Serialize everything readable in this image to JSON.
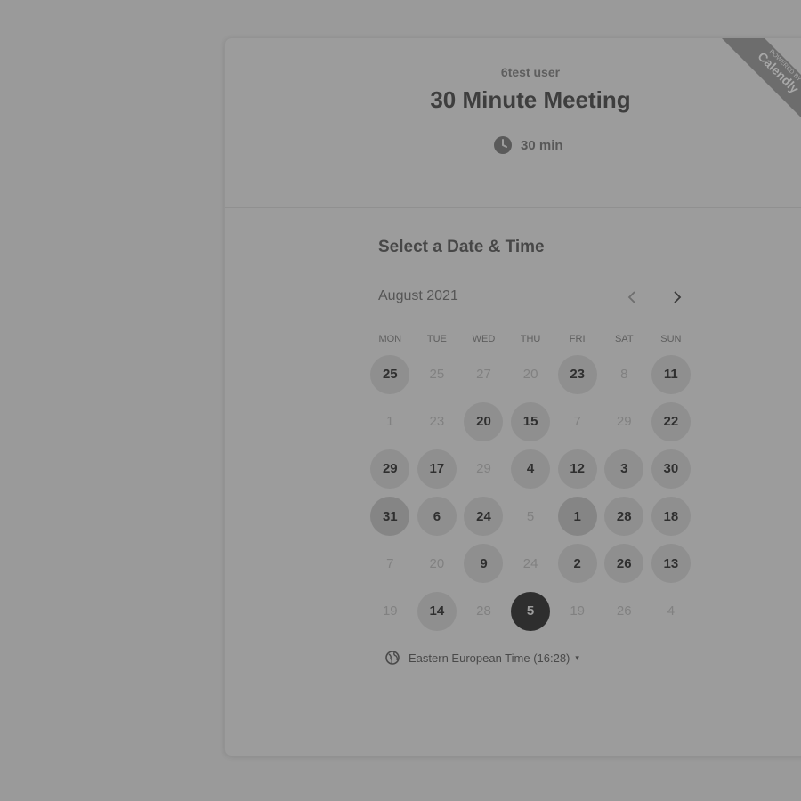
{
  "host": {
    "name": "6test user"
  },
  "event": {
    "title": "30 Minute Meeting",
    "duration": "30 min"
  },
  "ribbon": {
    "top": "POWERED BY",
    "main": "Calendly"
  },
  "calendar": {
    "section_title": "Select a Date & Time",
    "month": "August 2021",
    "prev_icon": "chevron-left-icon",
    "next_icon": "chevron-right-icon",
    "weekdays": [
      "MON",
      "TUE",
      "WED",
      "THU",
      "FRI",
      "SAT",
      "SUN"
    ],
    "days": [
      {
        "n": "25",
        "state": "available"
      },
      {
        "n": "25",
        "state": "unavailable"
      },
      {
        "n": "27",
        "state": "unavailable"
      },
      {
        "n": "20",
        "state": "unavailable"
      },
      {
        "n": "23",
        "state": "available"
      },
      {
        "n": "8",
        "state": "unavailable"
      },
      {
        "n": "11",
        "state": "available"
      },
      {
        "n": "1",
        "state": "unavailable"
      },
      {
        "n": "23",
        "state": "unavailable"
      },
      {
        "n": "20",
        "state": "available"
      },
      {
        "n": "15",
        "state": "available"
      },
      {
        "n": "7",
        "state": "unavailable"
      },
      {
        "n": "29",
        "state": "unavailable"
      },
      {
        "n": "22",
        "state": "available"
      },
      {
        "n": "29",
        "state": "available"
      },
      {
        "n": "17",
        "state": "available"
      },
      {
        "n": "29",
        "state": "unavailable"
      },
      {
        "n": "4",
        "state": "available"
      },
      {
        "n": "12",
        "state": "available"
      },
      {
        "n": "3",
        "state": "available"
      },
      {
        "n": "30",
        "state": "available"
      },
      {
        "n": "31",
        "state": "highlight"
      },
      {
        "n": "6",
        "state": "available"
      },
      {
        "n": "24",
        "state": "available"
      },
      {
        "n": "5",
        "state": "unavailable"
      },
      {
        "n": "1",
        "state": "highlight"
      },
      {
        "n": "28",
        "state": "available"
      },
      {
        "n": "18",
        "state": "available"
      },
      {
        "n": "7",
        "state": "unavailable"
      },
      {
        "n": "20",
        "state": "unavailable"
      },
      {
        "n": "9",
        "state": "available"
      },
      {
        "n": "24",
        "state": "unavailable"
      },
      {
        "n": "2",
        "state": "available"
      },
      {
        "n": "26",
        "state": "available"
      },
      {
        "n": "13",
        "state": "available"
      },
      {
        "n": "19",
        "state": "unavailable"
      },
      {
        "n": "14",
        "state": "available"
      },
      {
        "n": "28",
        "state": "unavailable"
      },
      {
        "n": "5",
        "state": "selected"
      },
      {
        "n": "19",
        "state": "unavailable"
      },
      {
        "n": "26",
        "state": "unavailable"
      },
      {
        "n": "4",
        "state": "unavailable"
      }
    ]
  },
  "timezone": {
    "label": "Eastern European Time (16:28)",
    "icon": "globe-icon",
    "caret": "▾"
  },
  "colors": {
    "overlay_bg": "#9a9a9a",
    "selected": "#2e2e2e",
    "available": "#8f8f8f"
  }
}
